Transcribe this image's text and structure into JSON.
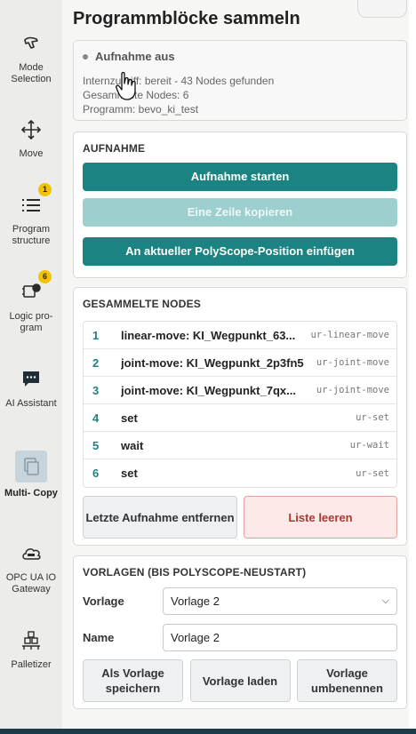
{
  "sidebar": {
    "items": [
      {
        "label": "Mode Selection",
        "icon": "hand-pointer-icon"
      },
      {
        "label": "Move",
        "icon": "move-arrows-icon"
      },
      {
        "label": "Program structure",
        "icon": "list-icon",
        "badge": "1"
      },
      {
        "label": "Logic pro- gram",
        "icon": "logic-chip-icon",
        "badge": "6"
      },
      {
        "label": "AI Assistant",
        "icon": "chat-bubble-icon"
      },
      {
        "label": "Multi- Copy",
        "icon": "copy-icon",
        "active": true
      },
      {
        "label": "OPC UA IO Gateway",
        "icon": "cloud-gateway-icon"
      },
      {
        "label": "Palletizer",
        "icon": "pallet-icon"
      }
    ]
  },
  "main": {
    "title": "Programmblöcke sammeln",
    "status": {
      "heading": "Aufnahme aus",
      "lines": [
        "Internzugriff: bereit - 43 Nodes gefunden",
        "Gesammelte Nodes: 6",
        "Programm: bevo_ki_test"
      ]
    },
    "recording": {
      "title": "AUFNAHME",
      "start_label": "Aufnahme starten",
      "copy_line_label": "Eine Zeile kopieren",
      "insert_label": "An aktueller PolyScope-Position einfügen"
    },
    "collected": {
      "title": "GESAMMELTE NODES",
      "nodes": [
        {
          "index": "1",
          "name": "linear-move: KI_Wegpunkt_63...",
          "type": "ur-linear-move"
        },
        {
          "index": "2",
          "name": "joint-move: KI_Wegpunkt_2p3fn5",
          "type": "ur-joint-move"
        },
        {
          "index": "3",
          "name": "joint-move: KI_Wegpunkt_7qx...",
          "type": "ur-joint-move"
        },
        {
          "index": "4",
          "name": "set",
          "type": "ur-set"
        },
        {
          "index": "5",
          "name": "wait",
          "type": "ur-wait"
        },
        {
          "index": "6",
          "name": "set",
          "type": "ur-set"
        }
      ],
      "remove_last_label": "Letzte Aufnahme entfernen",
      "clear_label": "Liste leeren"
    },
    "templates": {
      "title": "VORLAGEN (BIS POLYSCOPE-NEUSTART)",
      "template_label": "Vorlage",
      "template_value": "Vorlage 2",
      "name_label": "Name",
      "name_value": "Vorlage 2",
      "save_label": "Als Vorlage speichern",
      "load_label": "Vorlage laden",
      "rename_label": "Vorlage umbenennen"
    }
  },
  "colors": {
    "accent": "#1b8482",
    "badge": "#f2c200",
    "danger": "#b23530"
  }
}
